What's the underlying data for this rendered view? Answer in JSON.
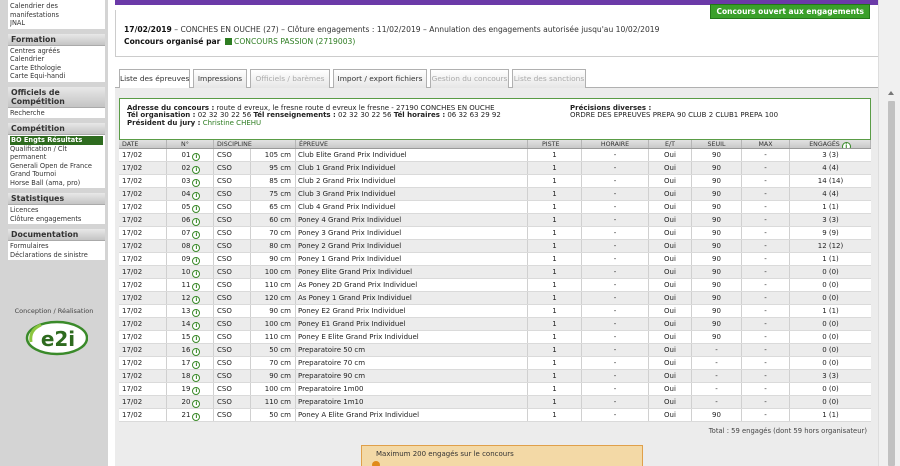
{
  "sidebar": {
    "top_items": [
      "Calendrier des",
      "manifestations",
      "JNAL"
    ],
    "sections": [
      {
        "title": "Formation",
        "items": [
          "Centres agréés",
          "Calendrier",
          "Carte Éthologie",
          "Carte Équi-handi"
        ]
      },
      {
        "title": "Officiels de Compétition",
        "items": [
          "Recherche"
        ]
      },
      {
        "title": "Compétition",
        "items": [
          "BO Engts Résultats",
          "Qualification / Clt permanent",
          "Generali Open de France",
          "Grand Tournoi",
          "Horse Ball (ama, pro)"
        ]
      },
      {
        "title": "Statistiques",
        "items": [
          "Licences",
          "Clôture engagements"
        ]
      },
      {
        "title": "Documentation",
        "items": [
          "Formulaires",
          "Déclarations de sinistre"
        ]
      }
    ],
    "active_item": "BO Engts Résultats",
    "credit": "Conception / Réalisation",
    "logo_text": "e2i"
  },
  "header": {
    "status_badge": "Concours ouvert aux engagements",
    "line1_date": "17/02/2019",
    "line1_rest": " –  CONCHES EN OUCHE  (27)  – Clôture engagements : 11/02/2019  – Annulation des engagements autorisée jusqu'au 10/02/2019",
    "line2_label": "Concours organisé par ",
    "line2_org": "CONCOURS PASSION (2719003)"
  },
  "tabs": [
    {
      "label": "Liste des épreuves",
      "state": "active"
    },
    {
      "label": "Impressions",
      "state": "normal"
    },
    {
      "label": "Officiels / barèmes",
      "state": "disabled"
    },
    {
      "label": "Import / export fichiers",
      "state": "normal"
    },
    {
      "label": "Gestion du concours",
      "state": "disabled"
    },
    {
      "label": "Liste des sanctions",
      "state": "disabled"
    }
  ],
  "address": {
    "line1_label": "Adresse du concours :",
    "line1_value": " route d evreux, le fresne route d evreux le fresne - 27190 CONCHES EN OUCHE",
    "line2_label1": "Tél organisation :",
    "line2_value1": " 02 32 30 22 56 ",
    "line2_label2": "Tél renseignements :",
    "line2_value2": " 02 32 30 22 56 ",
    "line2_label3": "Tél horaires :",
    "line2_value3": " 06 32 63 29 92",
    "line3_label": "Président du jury :",
    "line3_value": " Christine CHEHU",
    "precisions_label": "Précisions diverses :",
    "precisions_value": "ORDRE DES EPREUVES PREPA 90 CLUB 2 CLUB1 PREPA 100"
  },
  "table": {
    "headers": {
      "date": "DATE",
      "num": "N°",
      "discipline": "DISCIPLINE",
      "epreuve": "ÉPREUVE",
      "piste": "PISTE",
      "horaire": "HORAIRE",
      "et": "E/T",
      "seuil": "SEUIL",
      "max": "MAX",
      "engages": "ENGAGÉS"
    },
    "rows": [
      {
        "date": "17/02",
        "num": "01",
        "disc": "CSO",
        "h": "105 cm",
        "ep": "Club Elite Grand Prix Individuel",
        "piste": "1",
        "hor": "-",
        "et": "Oui",
        "seuil": "90",
        "max": "-",
        "eng": "3 (3)"
      },
      {
        "date": "17/02",
        "num": "02",
        "disc": "CSO",
        "h": "95 cm",
        "ep": "Club 1 Grand Prix Individuel",
        "piste": "1",
        "hor": "-",
        "et": "Oui",
        "seuil": "90",
        "max": "-",
        "eng": "4 (4)"
      },
      {
        "date": "17/02",
        "num": "03",
        "disc": "CSO",
        "h": "85 cm",
        "ep": "Club 2 Grand Prix Individuel",
        "piste": "1",
        "hor": "-",
        "et": "Oui",
        "seuil": "90",
        "max": "-",
        "eng": "14 (14)"
      },
      {
        "date": "17/02",
        "num": "04",
        "disc": "CSO",
        "h": "75 cm",
        "ep": "Club 3 Grand Prix Individuel",
        "piste": "1",
        "hor": "-",
        "et": "Oui",
        "seuil": "90",
        "max": "-",
        "eng": "4 (4)"
      },
      {
        "date": "17/02",
        "num": "05",
        "disc": "CSO",
        "h": "65 cm",
        "ep": "Club 4 Grand Prix Individuel",
        "piste": "1",
        "hor": "-",
        "et": "Oui",
        "seuil": "90",
        "max": "-",
        "eng": "1 (1)"
      },
      {
        "date": "17/02",
        "num": "06",
        "disc": "CSO",
        "h": "60 cm",
        "ep": "Poney 4 Grand Prix Individuel",
        "piste": "1",
        "hor": "-",
        "et": "Oui",
        "seuil": "90",
        "max": "-",
        "eng": "3 (3)"
      },
      {
        "date": "17/02",
        "num": "07",
        "disc": "CSO",
        "h": "70 cm",
        "ep": "Poney 3 Grand Prix Individuel",
        "piste": "1",
        "hor": "-",
        "et": "Oui",
        "seuil": "90",
        "max": "-",
        "eng": "9 (9)"
      },
      {
        "date": "17/02",
        "num": "08",
        "disc": "CSO",
        "h": "80 cm",
        "ep": "Poney 2 Grand Prix Individuel",
        "piste": "1",
        "hor": "-",
        "et": "Oui",
        "seuil": "90",
        "max": "-",
        "eng": "12 (12)"
      },
      {
        "date": "17/02",
        "num": "09",
        "disc": "CSO",
        "h": "90 cm",
        "ep": "Poney 1 Grand Prix Individuel",
        "piste": "1",
        "hor": "-",
        "et": "Oui",
        "seuil": "90",
        "max": "-",
        "eng": "1 (1)"
      },
      {
        "date": "17/02",
        "num": "10",
        "disc": "CSO",
        "h": "100 cm",
        "ep": "Poney Elite Grand Prix Individuel",
        "piste": "1",
        "hor": "-",
        "et": "Oui",
        "seuil": "90",
        "max": "-",
        "eng": "0 (0)"
      },
      {
        "date": "17/02",
        "num": "11",
        "disc": "CSO",
        "h": "110 cm",
        "ep": "As Poney 2D Grand Prix Individuel",
        "piste": "1",
        "hor": "-",
        "et": "Oui",
        "seuil": "90",
        "max": "-",
        "eng": "0 (0)"
      },
      {
        "date": "17/02",
        "num": "12",
        "disc": "CSO",
        "h": "120 cm",
        "ep": "As Poney 1 Grand Prix Individuel",
        "piste": "1",
        "hor": "-",
        "et": "Oui",
        "seuil": "90",
        "max": "-",
        "eng": "0 (0)"
      },
      {
        "date": "17/02",
        "num": "13",
        "disc": "CSO",
        "h": "90 cm",
        "ep": "Poney E2 Grand Prix Individuel",
        "piste": "1",
        "hor": "-",
        "et": "Oui",
        "seuil": "90",
        "max": "-",
        "eng": "1 (1)"
      },
      {
        "date": "17/02",
        "num": "14",
        "disc": "CSO",
        "h": "100 cm",
        "ep": "Poney E1 Grand Prix Individuel",
        "piste": "1",
        "hor": "-",
        "et": "Oui",
        "seuil": "90",
        "max": "-",
        "eng": "0 (0)"
      },
      {
        "date": "17/02",
        "num": "15",
        "disc": "CSO",
        "h": "110 cm",
        "ep": "Poney E Elite Grand Prix Individuel",
        "piste": "1",
        "hor": "-",
        "et": "Oui",
        "seuil": "90",
        "max": "-",
        "eng": "0 (0)"
      },
      {
        "date": "17/02",
        "num": "16",
        "disc": "CSO",
        "h": "50 cm",
        "ep": "Preparatoire 50 cm",
        "piste": "1",
        "hor": "-",
        "et": "Oui",
        "seuil": "-",
        "max": "-",
        "eng": "0 (0)"
      },
      {
        "date": "17/02",
        "num": "17",
        "disc": "CSO",
        "h": "70 cm",
        "ep": "Preparatoire 70 cm",
        "piste": "1",
        "hor": "-",
        "et": "Oui",
        "seuil": "-",
        "max": "-",
        "eng": "0 (0)"
      },
      {
        "date": "17/02",
        "num": "18",
        "disc": "CSO",
        "h": "90 cm",
        "ep": "Preparatoire 90 cm",
        "piste": "1",
        "hor": "-",
        "et": "Oui",
        "seuil": "-",
        "max": "-",
        "eng": "3 (3)"
      },
      {
        "date": "17/02",
        "num": "19",
        "disc": "CSO",
        "h": "100 cm",
        "ep": "Preparatoire 1m00",
        "piste": "1",
        "hor": "-",
        "et": "Oui",
        "seuil": "-",
        "max": "-",
        "eng": "0 (0)"
      },
      {
        "date": "17/02",
        "num": "20",
        "disc": "CSO",
        "h": "110 cm",
        "ep": "Preparatoire 1m10",
        "piste": "1",
        "hor": "-",
        "et": "Oui",
        "seuil": "-",
        "max": "-",
        "eng": "0 (0)"
      },
      {
        "date": "17/02",
        "num": "21",
        "disc": "CSO",
        "h": "50 cm",
        "ep": "Poney A Elite Grand Prix Individuel",
        "piste": "1",
        "hor": "-",
        "et": "Oui",
        "seuil": "90",
        "max": "-",
        "eng": "1 (1)"
      }
    ],
    "total": "Total : 59 engagés (dont 59 hors organisateur)"
  },
  "notice": {
    "text": "Maximum 200 engagés sur le concours"
  },
  "colors": {
    "accent": "#2e7d22",
    "topbar": "#6b3aa8",
    "badge": "#3aa02a",
    "notice_bg": "#f3d9a6"
  }
}
